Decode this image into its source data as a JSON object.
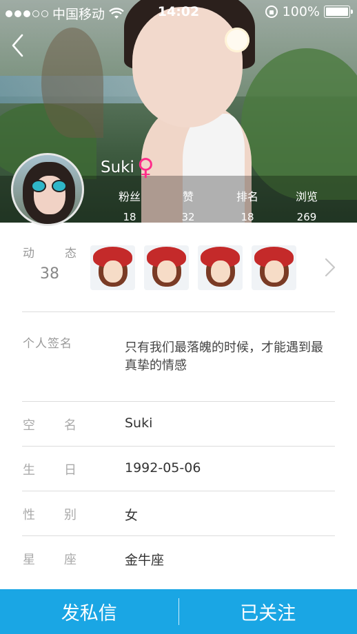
{
  "status_bar": {
    "carrier": "中国移动",
    "time": "14:02",
    "battery": "100%",
    "signal_bars_filled": 3,
    "signal_bars_total": 5
  },
  "profile": {
    "name": "Suki",
    "gender_symbol": "♀",
    "gender_color": "#ff2d8a",
    "stats": [
      {
        "label": "粉丝",
        "value": "18"
      },
      {
        "label": "赞",
        "value": "32"
      },
      {
        "label": "排名",
        "value": "18"
      },
      {
        "label": "浏览",
        "value": "269"
      }
    ]
  },
  "dynamics": {
    "label_1": "动",
    "label_2": "态",
    "count": "38",
    "thumbnails": [
      "cartoon-girl-thinking",
      "cartoon-girl-cheeks",
      "cartoon-girl-smile",
      "cartoon-girl-wave"
    ]
  },
  "signature": {
    "label": "个人签名",
    "text": "只有我们最落魄的时候，才能遇到最真挚的情感"
  },
  "info_rows": [
    {
      "label_1": "空",
      "label_2": "名",
      "value": "Suki"
    },
    {
      "label_1": "生",
      "label_2": "日",
      "value": "1992-05-06"
    },
    {
      "label_1": "性",
      "label_2": "别",
      "value": "女"
    },
    {
      "label_1": "星",
      "label_2": "座",
      "value": "金牛座"
    }
  ],
  "actions": {
    "message": "发私信",
    "follow": "已关注"
  },
  "colors": {
    "accent": "#1aa6e4",
    "divider": "#dcdcdc"
  }
}
